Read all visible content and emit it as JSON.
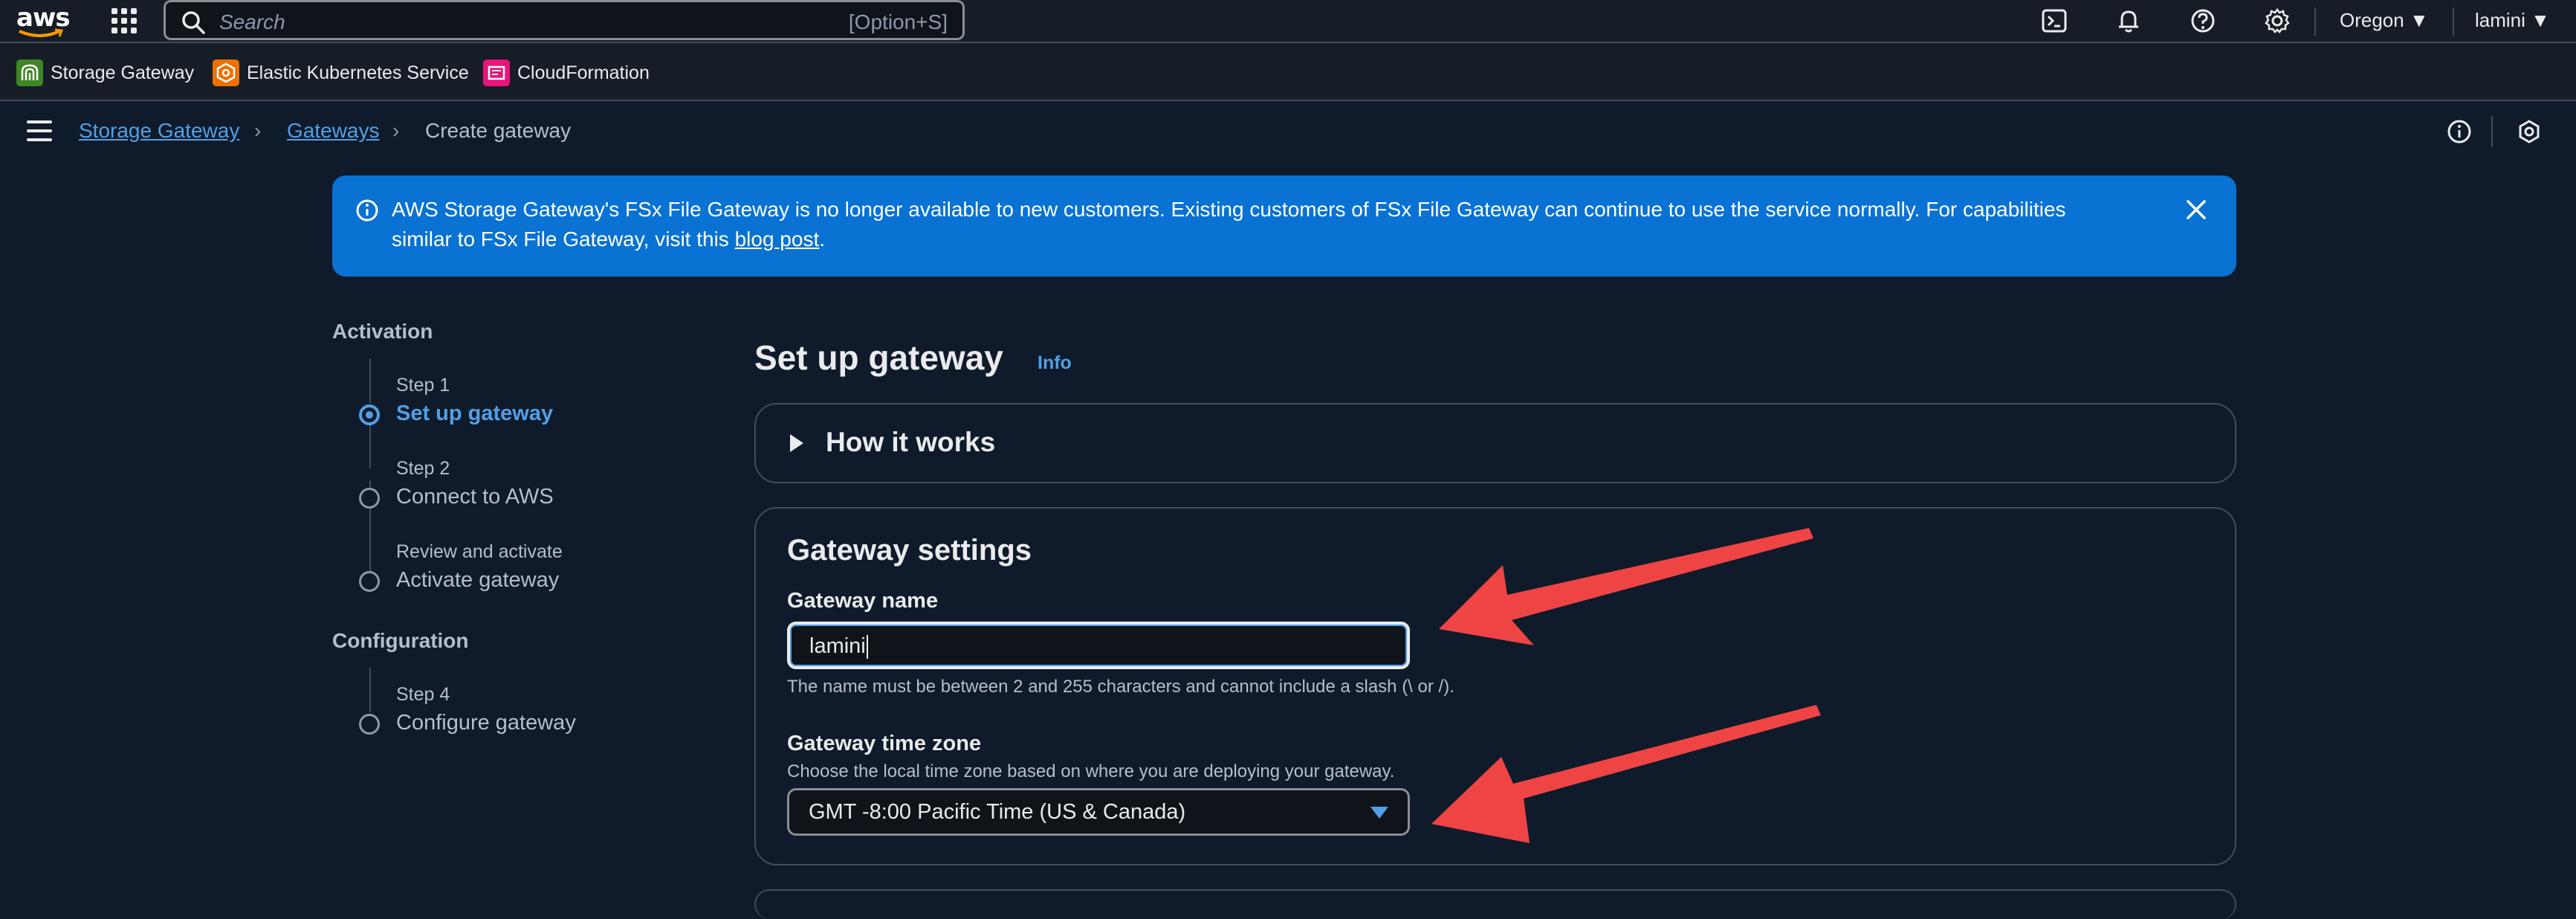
{
  "topnav": {
    "logo_text": "aws",
    "search_placeholder": "Search",
    "search_shortcut": "[Option+S]",
    "region": "Oregon ▼",
    "user": "lamini ▼"
  },
  "favorites": [
    {
      "label": "Storage Gateway",
      "color": "#3f8624"
    },
    {
      "label": "Elastic Kubernetes Service",
      "color": "#ed7100"
    },
    {
      "label": "CloudFormation",
      "color": "#e7157b"
    }
  ],
  "breadcrumb": {
    "items": [
      "Storage Gateway",
      "Gateways"
    ],
    "current": "Create gateway"
  },
  "alert": {
    "text_before": "AWS Storage Gateway's FSx File Gateway is no longer available to new customers. Existing customers of FSx File Gateway can continue to use the service normally. For capabilities similar to FSx File Gateway, visit this ",
    "link": "blog post",
    "text_after": "."
  },
  "wizard": {
    "section1": "Activation",
    "section2": "Configuration",
    "steps": [
      {
        "small": "Step 1",
        "title": "Set up gateway"
      },
      {
        "small": "Step 2",
        "title": "Connect to AWS"
      },
      {
        "small": "Review and activate",
        "title": "Activate gateway"
      },
      {
        "small": "Step 4",
        "title": "Configure gateway"
      }
    ]
  },
  "main": {
    "title": "Set up gateway",
    "info": "Info",
    "how_it_works": "How it works",
    "settings": {
      "heading": "Gateway settings",
      "name_label": "Gateway name",
      "name_value": "lamini",
      "name_hint": "The name must be between 2 and 255 characters and cannot include a slash (\\ or /).",
      "tz_label": "Gateway time zone",
      "tz_desc": "Choose the local time zone based on where you are deploying your gateway.",
      "tz_value": "GMT -8:00 Pacific Time (US & Canada)"
    }
  },
  "colors": {
    "accent": "#539fe5",
    "alert_bg": "#0972d3",
    "annotation_arrow": "#ef4444"
  }
}
